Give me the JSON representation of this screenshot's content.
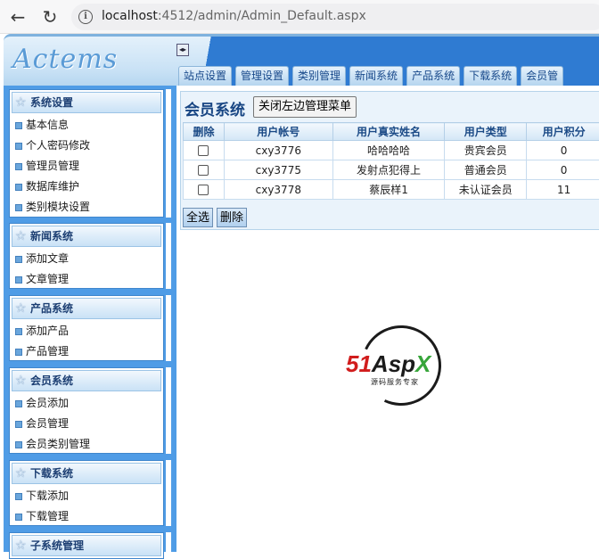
{
  "browser": {
    "url_host": "localhost",
    "url_rest": ":4512/admin/Admin_Default.aspx"
  },
  "header": {
    "logo": "Actems",
    "toggle_label": "◂▸",
    "tabs": [
      "站点设置",
      "管理设置",
      "类别管理",
      "新闻系统",
      "产品系统",
      "下载系统",
      "会员管"
    ]
  },
  "sidebar": {
    "groups": [
      {
        "title": "系统设置",
        "items": [
          "基本信息",
          "个人密码修改",
          "管理员管理",
          "数据库维护",
          "类别模块设置"
        ]
      },
      {
        "title": "新闻系统",
        "items": [
          "添加文章",
          "文章管理"
        ]
      },
      {
        "title": "产品系统",
        "items": [
          "添加产品",
          "产品管理"
        ]
      },
      {
        "title": "会员系统",
        "items": [
          "会员添加",
          "会员管理",
          "会员类别管理"
        ]
      },
      {
        "title": "下载系统",
        "items": [
          "下载添加",
          "下载管理"
        ]
      },
      {
        "title": "子系统管理",
        "items": []
      }
    ]
  },
  "main": {
    "title": "会员系统",
    "close_menu_label": "关闭左边管理菜单",
    "columns": [
      "删除",
      "用户帐号",
      "用户真实姓名",
      "用户类型",
      "用户积分"
    ],
    "rows": [
      {
        "account": "cxy3776",
        "name": "哈哈哈哈",
        "type": "贵宾会员",
        "points": "0"
      },
      {
        "account": "cxy3775",
        "name": "发射点犯得上",
        "type": "普通会员",
        "points": "0"
      },
      {
        "account": "cxy3778",
        "name": "蔡辰样1",
        "type": "未认证会员",
        "points": "11"
      }
    ],
    "select_all_label": "全选",
    "delete_label": "删除"
  },
  "watermark": {
    "brand_51": "51",
    "brand_asp": "Asp",
    "brand_x": "X",
    "tagline": "源码服务专家"
  }
}
